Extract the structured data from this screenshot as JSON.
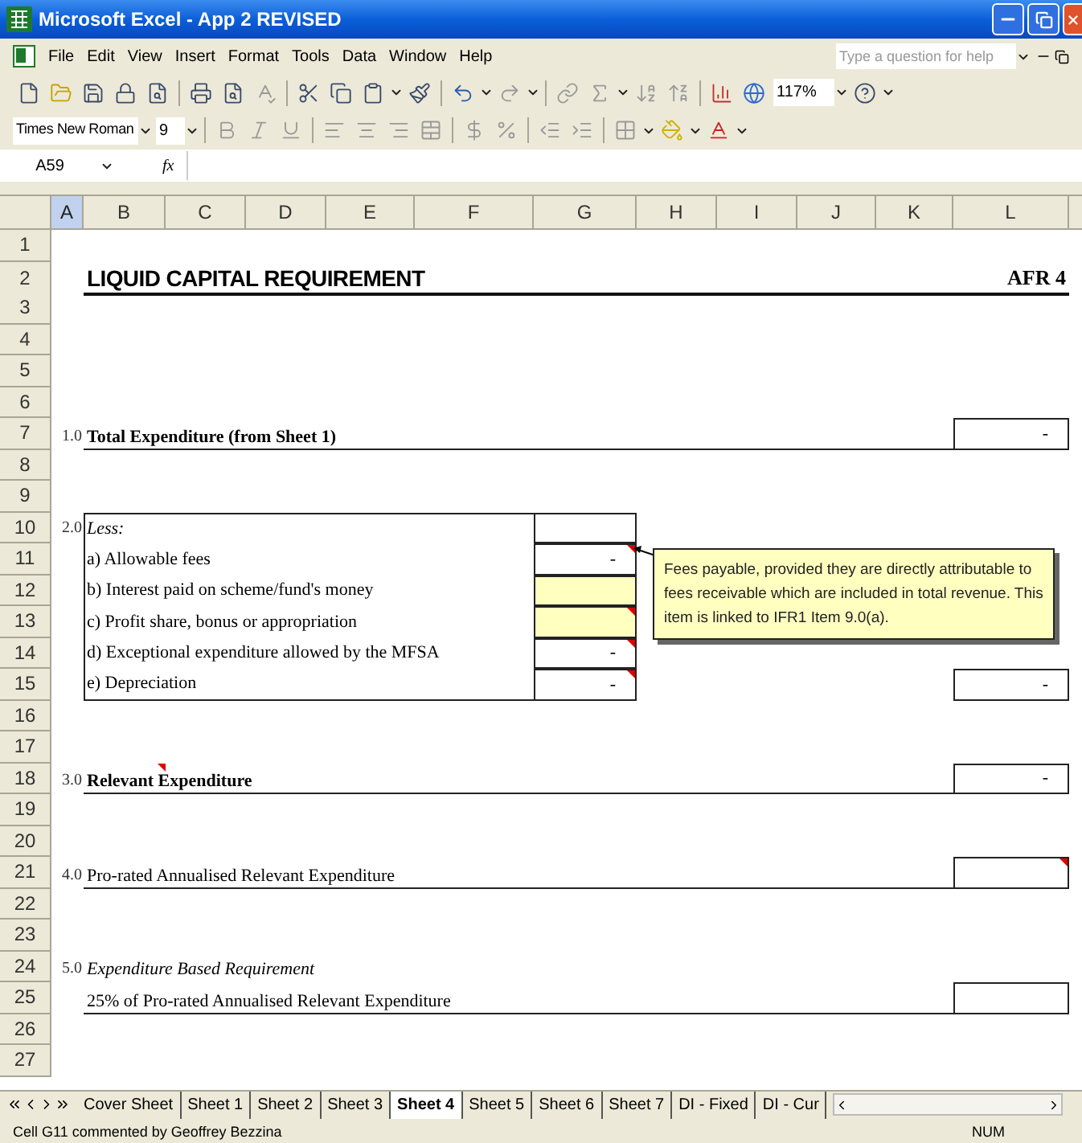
{
  "window": {
    "title": "Microsoft Excel - App 2 REVISED"
  },
  "menu": [
    "File",
    "Edit",
    "View",
    "Insert",
    "Format",
    "Tools",
    "Data",
    "Window",
    "Help"
  ],
  "help_search": {
    "placeholder": "Type a question for help"
  },
  "toolbar": {
    "zoom": "117%"
  },
  "format_bar": {
    "font": "Times New Roman",
    "size": "9"
  },
  "formula_bar": {
    "name_box": "A59",
    "fx": "fx"
  },
  "columns": [
    {
      "label": "A",
      "selected": true
    },
    {
      "label": "B",
      "selected": false
    },
    {
      "label": "C",
      "selected": false
    },
    {
      "label": "D",
      "selected": false
    },
    {
      "label": "E",
      "selected": false
    },
    {
      "label": "F",
      "selected": false
    },
    {
      "label": "G",
      "selected": false
    },
    {
      "label": "H",
      "selected": false
    },
    {
      "label": "I",
      "selected": false
    },
    {
      "label": "J",
      "selected": false
    },
    {
      "label": "K",
      "selected": false
    },
    {
      "label": "L",
      "selected": false
    }
  ],
  "rows": [
    {
      "kind": "blank",
      "number": "1"
    },
    {
      "kind": "title",
      "number": "2",
      "text": "LIQUID CAPITAL REQUIREMENT",
      "code": "AFR 4"
    },
    {
      "kind": "blank",
      "number": "3"
    },
    {
      "kind": "blank",
      "number": "4"
    },
    {
      "kind": "blank",
      "number": "5"
    },
    {
      "kind": "blank",
      "number": "6"
    },
    {
      "kind": "total",
      "number": "7",
      "index": "1.0",
      "text": "Total Expenditure (from Sheet 1)",
      "comment": false,
      "total": {
        "value": "-",
        "comment": false
      }
    },
    {
      "kind": "blank",
      "number": "8"
    },
    {
      "kind": "blank",
      "number": "9"
    },
    {
      "kind": "table",
      "index": "2.0",
      "rows": [
        {
          "kind": "heading",
          "number": "10",
          "text": "Less:",
          "cell": {
            "highlighted": false,
            "comment": false
          }
        },
        {
          "kind": "item",
          "number": "11",
          "text": "a) Allowable fees",
          "cell": {
            "value": "-",
            "highlighted": false,
            "comment": true
          }
        },
        {
          "kind": "item",
          "number": "12",
          "text": "b) Interest paid on scheme/fund's money",
          "cell": {
            "highlighted": true,
            "comment": false
          }
        },
        {
          "kind": "item",
          "number": "13",
          "text": "c) Profit share, bonus or appropriation",
          "cell": {
            "highlighted": true,
            "comment": true
          }
        },
        {
          "kind": "item",
          "number": "14",
          "text": "d) Exceptional expenditure allowed by the MFSA",
          "cell": {
            "value": "-",
            "highlighted": false,
            "comment": true
          }
        },
        {
          "kind": "item",
          "number": "15",
          "text": "e) Depreciation",
          "cell": {
            "value": "-",
            "highlighted": false,
            "comment": true
          },
          "total": {
            "value": "-",
            "comment": false
          }
        }
      ]
    },
    {
      "kind": "blank",
      "number": "16"
    },
    {
      "kind": "blank",
      "number": "17"
    },
    {
      "kind": "total",
      "number": "18",
      "index": "3.0",
      "text": "Relevant Expenditure",
      "comment": true,
      "total": {
        "value": "-",
        "comment": false
      }
    },
    {
      "kind": "blank",
      "number": "19"
    },
    {
      "kind": "blank",
      "number": "20"
    },
    {
      "kind": "line",
      "number": "21",
      "index": "4.0",
      "text": "Pro-rated Annualised Relevant Expenditure",
      "comment": false,
      "total": {
        "comment": true
      }
    },
    {
      "kind": "blank",
      "number": "22"
    },
    {
      "kind": "blank",
      "number": "23"
    },
    {
      "kind": "heading",
      "number": "24",
      "index": "5.0",
      "text": "Expenditure Based Requirement",
      "comment": false
    },
    {
      "kind": "line",
      "number": "25",
      "text": "25% of Pro-rated Annualised Relevant Expenditure",
      "comment": false,
      "total": {
        "comment": false
      }
    },
    {
      "kind": "blank",
      "number": "26"
    },
    {
      "kind": "blank",
      "number": "27"
    }
  ],
  "comment_popup": {
    "text": "Fees payable, provided they are directly attributable to fees receivable which are included in total revenue. This item is linked to IFR1 Item 9.0(a)."
  },
  "sheet_tabs": [
    {
      "label": "Cover Sheet",
      "selected": false
    },
    {
      "label": "Sheet 1",
      "selected": false
    },
    {
      "label": "Sheet 2",
      "selected": false
    },
    {
      "label": "Sheet 3",
      "selected": false
    },
    {
      "label": "Sheet 4",
      "selected": true
    },
    {
      "label": "Sheet 5",
      "selected": false
    },
    {
      "label": "Sheet 6",
      "selected": false
    },
    {
      "label": "Sheet 7",
      "selected": false
    },
    {
      "label": "DI - Fixed",
      "selected": false
    },
    {
      "label": "DI - Cur",
      "selected": false
    }
  ],
  "status_bar": {
    "message": "Cell G11 commented by Geoffrey Bezzina",
    "indicator": "NUM"
  }
}
